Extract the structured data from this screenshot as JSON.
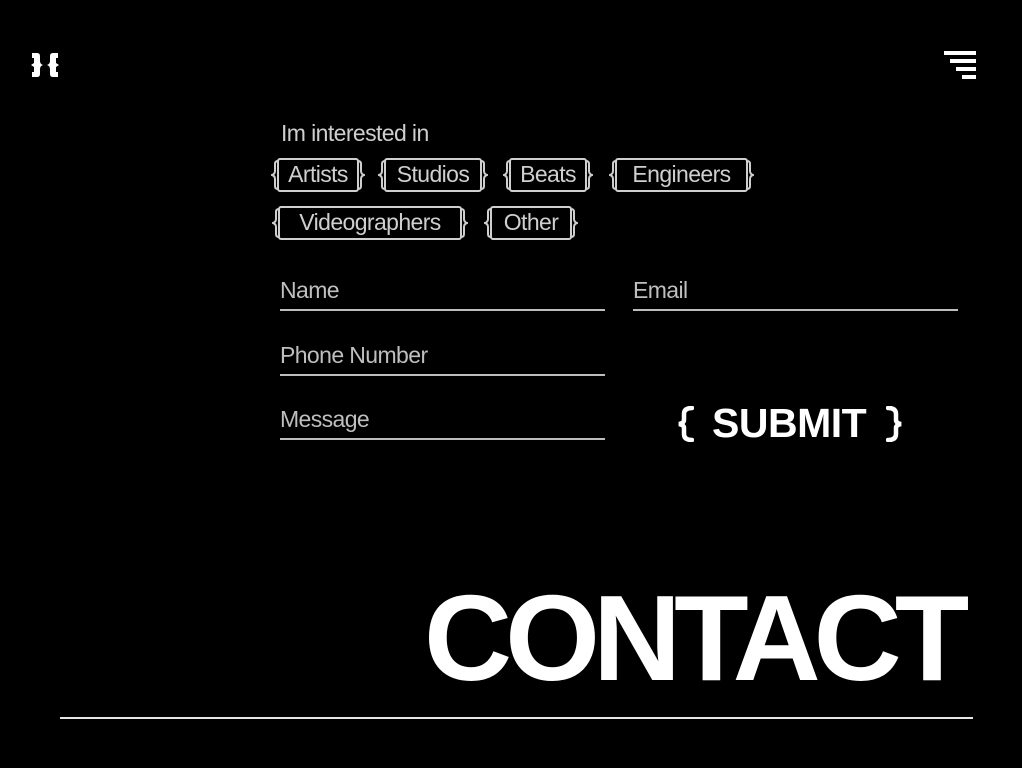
{
  "nav": {
    "logo_icon": "brace-logo-icon",
    "menu_icon": "hamburger-menu-icon"
  },
  "form": {
    "interest_label": "Im interested in",
    "interests": [
      {
        "label": "Artists"
      },
      {
        "label": "Studios"
      },
      {
        "label": "Beats"
      },
      {
        "label": "Engineers"
      },
      {
        "label": "Videographers"
      },
      {
        "label": "Other"
      }
    ],
    "fields": {
      "name_placeholder": "Name",
      "email_placeholder": "Email",
      "phone_placeholder": "Phone Number",
      "message_placeholder": "Message"
    },
    "submit_label": "SUBMIT"
  },
  "page": {
    "title": "CONTACT"
  },
  "colors": {
    "background": "#000000",
    "text": "#cfcfcf",
    "accent": "#ffffff"
  }
}
